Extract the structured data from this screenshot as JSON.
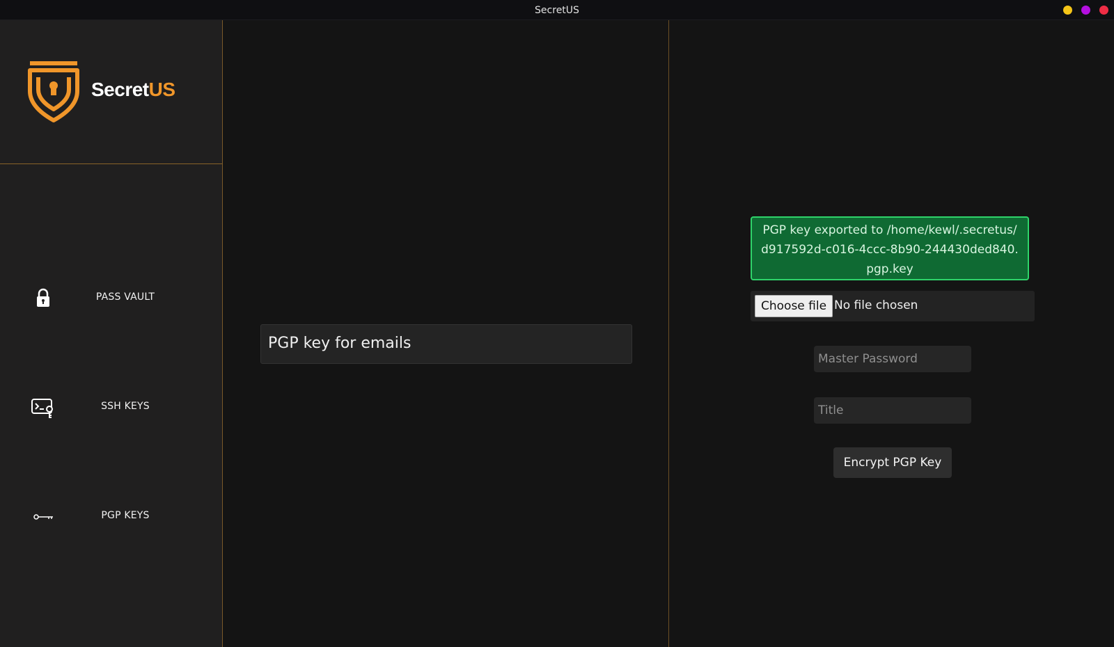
{
  "window": {
    "title": "SecretUS"
  },
  "brand": {
    "name_part1": "Secret",
    "name_part2": "US"
  },
  "sidebar": {
    "items": [
      {
        "label": "PASS VAULT",
        "icon": "lock-icon"
      },
      {
        "label": "SSH KEYS",
        "icon": "terminal-key-icon"
      },
      {
        "label": "PGP KEYS",
        "icon": "key-icon"
      }
    ]
  },
  "list": {
    "items": [
      {
        "title": "PGP key for emails"
      }
    ]
  },
  "form": {
    "alert": "PGP key exported to /home/kewl/.secretus/d917592d-c016-4ccc-8b90-244430ded840.pgp.key",
    "file_button": "Choose file",
    "file_status": "No file chosen",
    "master_password_placeholder": "Master Password",
    "title_placeholder": "Title",
    "submit_label": "Encrypt PGP Key"
  },
  "colors": {
    "accent": "#f0962a",
    "success_bg": "#0f6a33",
    "success_border": "#2fd46a",
    "sidebar_bg": "#201f1f",
    "main_bg": "#141414"
  }
}
